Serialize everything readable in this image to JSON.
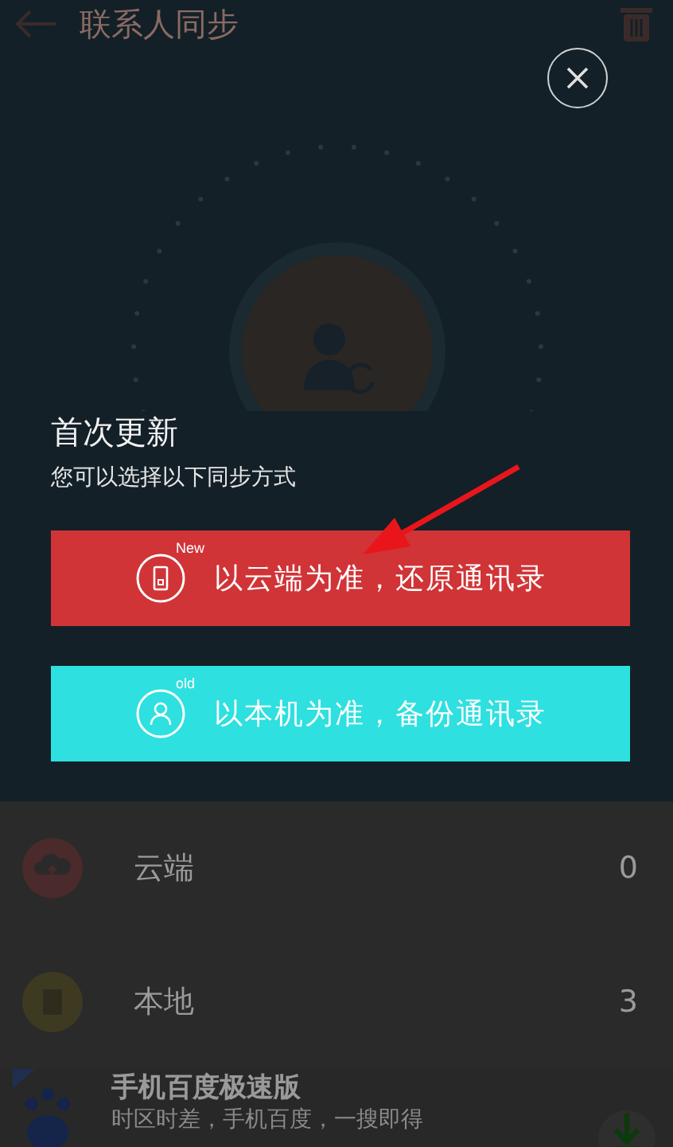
{
  "app_bar": {
    "title": "联系人同步"
  },
  "dialog": {
    "title": "首次更新",
    "subtitle": "您可以选择以下同步方式",
    "options": [
      {
        "kind": "cloud",
        "badge": "New",
        "label": "以云端为准，还原通讯录",
        "color": "#d03437"
      },
      {
        "kind": "local",
        "badge": "old",
        "label": "以本机为准，备份通讯录",
        "color": "#2ee0df"
      }
    ]
  },
  "sources": [
    {
      "kind": "cloud",
      "label": "云端",
      "count": "0"
    },
    {
      "kind": "local",
      "label": "本地",
      "count": "3"
    }
  ],
  "ad": {
    "title": "手机百度极速版",
    "subtitle": "时区时差，手机百度，一搜即得"
  }
}
